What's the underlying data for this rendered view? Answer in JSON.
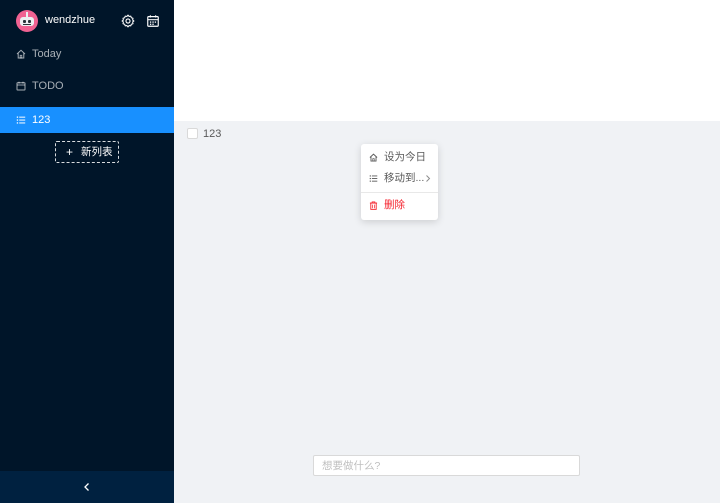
{
  "user": {
    "name": "wendzhue"
  },
  "sidebar": {
    "items": [
      {
        "label": "Today",
        "icon": "home-icon"
      },
      {
        "label": "TODO",
        "icon": "calendar-icon"
      },
      {
        "label": "123",
        "icon": "list-icon",
        "active": true
      }
    ],
    "new_list_label": "新列表",
    "new_list_icon": "plus-icon",
    "collapse_icon": "chevron-left-icon"
  },
  "todos": [
    {
      "text": "123",
      "done": false
    }
  ],
  "context_menu": {
    "items": [
      {
        "label": "设为今日",
        "icon": "home-icon"
      },
      {
        "label": "移动到...",
        "icon": "list-icon",
        "submenu": true
      },
      {
        "label": "删除",
        "icon": "trash-icon",
        "danger": true
      }
    ]
  },
  "add_todo": {
    "placeholder": "想要做什么?",
    "value": ""
  },
  "colors": {
    "sidebar_bg": "#001529",
    "active": "#1890ff",
    "danger": "#f5222d",
    "content_bg": "#f0f2f5"
  }
}
